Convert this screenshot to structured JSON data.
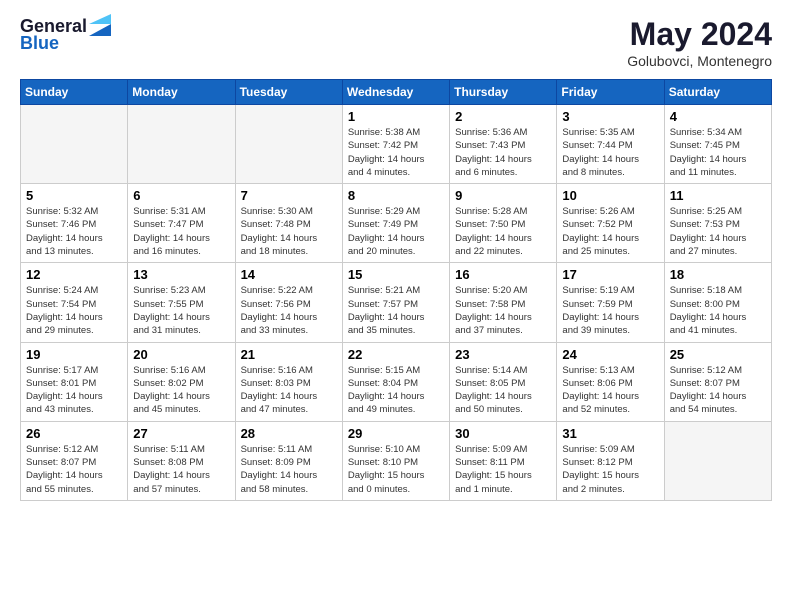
{
  "header": {
    "logo_general": "General",
    "logo_blue": "Blue",
    "month_year": "May 2024",
    "location": "Golubovci, Montenegro"
  },
  "days_of_week": [
    "Sunday",
    "Monday",
    "Tuesday",
    "Wednesday",
    "Thursday",
    "Friday",
    "Saturday"
  ],
  "weeks": [
    [
      {
        "num": "",
        "info": ""
      },
      {
        "num": "",
        "info": ""
      },
      {
        "num": "",
        "info": ""
      },
      {
        "num": "1",
        "info": "Sunrise: 5:38 AM\nSunset: 7:42 PM\nDaylight: 14 hours\nand 4 minutes."
      },
      {
        "num": "2",
        "info": "Sunrise: 5:36 AM\nSunset: 7:43 PM\nDaylight: 14 hours\nand 6 minutes."
      },
      {
        "num": "3",
        "info": "Sunrise: 5:35 AM\nSunset: 7:44 PM\nDaylight: 14 hours\nand 8 minutes."
      },
      {
        "num": "4",
        "info": "Sunrise: 5:34 AM\nSunset: 7:45 PM\nDaylight: 14 hours\nand 11 minutes."
      }
    ],
    [
      {
        "num": "5",
        "info": "Sunrise: 5:32 AM\nSunset: 7:46 PM\nDaylight: 14 hours\nand 13 minutes."
      },
      {
        "num": "6",
        "info": "Sunrise: 5:31 AM\nSunset: 7:47 PM\nDaylight: 14 hours\nand 16 minutes."
      },
      {
        "num": "7",
        "info": "Sunrise: 5:30 AM\nSunset: 7:48 PM\nDaylight: 14 hours\nand 18 minutes."
      },
      {
        "num": "8",
        "info": "Sunrise: 5:29 AM\nSunset: 7:49 PM\nDaylight: 14 hours\nand 20 minutes."
      },
      {
        "num": "9",
        "info": "Sunrise: 5:28 AM\nSunset: 7:50 PM\nDaylight: 14 hours\nand 22 minutes."
      },
      {
        "num": "10",
        "info": "Sunrise: 5:26 AM\nSunset: 7:52 PM\nDaylight: 14 hours\nand 25 minutes."
      },
      {
        "num": "11",
        "info": "Sunrise: 5:25 AM\nSunset: 7:53 PM\nDaylight: 14 hours\nand 27 minutes."
      }
    ],
    [
      {
        "num": "12",
        "info": "Sunrise: 5:24 AM\nSunset: 7:54 PM\nDaylight: 14 hours\nand 29 minutes."
      },
      {
        "num": "13",
        "info": "Sunrise: 5:23 AM\nSunset: 7:55 PM\nDaylight: 14 hours\nand 31 minutes."
      },
      {
        "num": "14",
        "info": "Sunrise: 5:22 AM\nSunset: 7:56 PM\nDaylight: 14 hours\nand 33 minutes."
      },
      {
        "num": "15",
        "info": "Sunrise: 5:21 AM\nSunset: 7:57 PM\nDaylight: 14 hours\nand 35 minutes."
      },
      {
        "num": "16",
        "info": "Sunrise: 5:20 AM\nSunset: 7:58 PM\nDaylight: 14 hours\nand 37 minutes."
      },
      {
        "num": "17",
        "info": "Sunrise: 5:19 AM\nSunset: 7:59 PM\nDaylight: 14 hours\nand 39 minutes."
      },
      {
        "num": "18",
        "info": "Sunrise: 5:18 AM\nSunset: 8:00 PM\nDaylight: 14 hours\nand 41 minutes."
      }
    ],
    [
      {
        "num": "19",
        "info": "Sunrise: 5:17 AM\nSunset: 8:01 PM\nDaylight: 14 hours\nand 43 minutes."
      },
      {
        "num": "20",
        "info": "Sunrise: 5:16 AM\nSunset: 8:02 PM\nDaylight: 14 hours\nand 45 minutes."
      },
      {
        "num": "21",
        "info": "Sunrise: 5:16 AM\nSunset: 8:03 PM\nDaylight: 14 hours\nand 47 minutes."
      },
      {
        "num": "22",
        "info": "Sunrise: 5:15 AM\nSunset: 8:04 PM\nDaylight: 14 hours\nand 49 minutes."
      },
      {
        "num": "23",
        "info": "Sunrise: 5:14 AM\nSunset: 8:05 PM\nDaylight: 14 hours\nand 50 minutes."
      },
      {
        "num": "24",
        "info": "Sunrise: 5:13 AM\nSunset: 8:06 PM\nDaylight: 14 hours\nand 52 minutes."
      },
      {
        "num": "25",
        "info": "Sunrise: 5:12 AM\nSunset: 8:07 PM\nDaylight: 14 hours\nand 54 minutes."
      }
    ],
    [
      {
        "num": "26",
        "info": "Sunrise: 5:12 AM\nSunset: 8:07 PM\nDaylight: 14 hours\nand 55 minutes."
      },
      {
        "num": "27",
        "info": "Sunrise: 5:11 AM\nSunset: 8:08 PM\nDaylight: 14 hours\nand 57 minutes."
      },
      {
        "num": "28",
        "info": "Sunrise: 5:11 AM\nSunset: 8:09 PM\nDaylight: 14 hours\nand 58 minutes."
      },
      {
        "num": "29",
        "info": "Sunrise: 5:10 AM\nSunset: 8:10 PM\nDaylight: 15 hours\nand 0 minutes."
      },
      {
        "num": "30",
        "info": "Sunrise: 5:09 AM\nSunset: 8:11 PM\nDaylight: 15 hours\nand 1 minute."
      },
      {
        "num": "31",
        "info": "Sunrise: 5:09 AM\nSunset: 8:12 PM\nDaylight: 15 hours\nand 2 minutes."
      },
      {
        "num": "",
        "info": ""
      }
    ]
  ]
}
